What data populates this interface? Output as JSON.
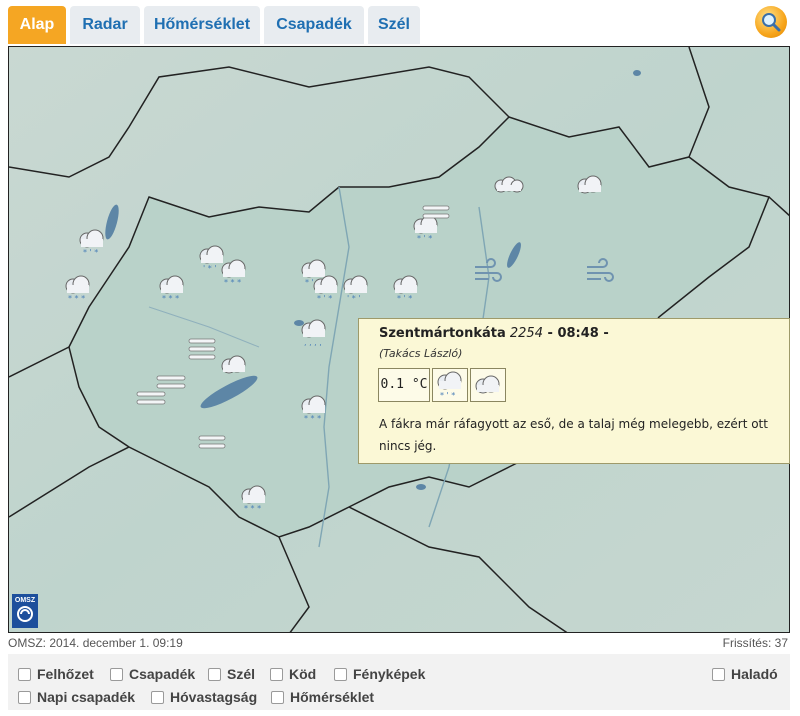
{
  "tabs": [
    {
      "label": "Alap",
      "active": true
    },
    {
      "label": "Radar",
      "active": false
    },
    {
      "label": "Hőmérséklet",
      "active": false
    },
    {
      "label": "Csapadék",
      "active": false
    },
    {
      "label": "Szél",
      "active": false
    }
  ],
  "search": {
    "icon": "search-icon"
  },
  "map": {
    "logo_text": "OMSZ",
    "popup": {
      "station": "Szentmártonkáta",
      "code": "2254",
      "separator": " - ",
      "time": "08:48 -",
      "author": "(Takács László)",
      "temperature": "0.1 °C",
      "icons": [
        "sleet-cloud-icon",
        "cloudy-icon"
      ],
      "note": "A fákra már ráfagyott az eső, de a talaj még melegebb, ezért ott nincs jég."
    }
  },
  "footer": {
    "source": "OMSZ: 2014. december 1. 09:19",
    "refresh": "Frissítés: 37"
  },
  "options": {
    "row1": [
      "Felhőzet",
      "Csapadék",
      "Szél",
      "Köd",
      "Fényképek"
    ],
    "advanced": "Haladó",
    "row2": [
      "Napi csapadék",
      "Hóvastagság",
      "Hőmérséklet"
    ]
  },
  "colors": {
    "active_tab": "#f5a623",
    "tab_text": "#1f6fb2",
    "popup_bg": "#fbf8d6"
  }
}
